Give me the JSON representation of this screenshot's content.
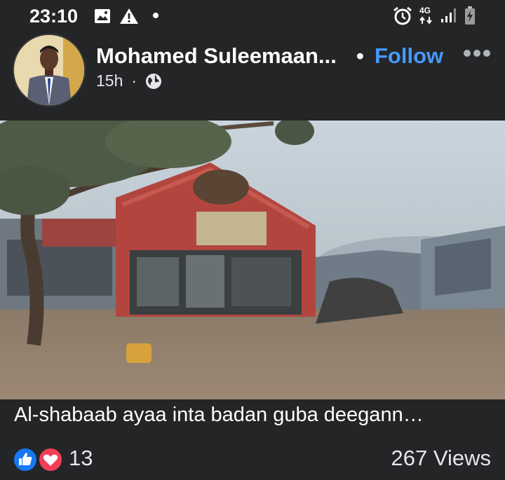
{
  "status_bar": {
    "time": "23:10",
    "network": "4G",
    "icons": [
      "image-icon",
      "warning-icon",
      "notification-dot-icon",
      "alarm-icon",
      "network-4g-icon",
      "signal-icon",
      "battery-charging-icon"
    ]
  },
  "post": {
    "author": "Mohamed Suleemaan...",
    "separator": "•",
    "follow_label": "Follow",
    "time_ago": "15h",
    "meta_separator": "·",
    "privacy_icon": "globe-icon",
    "caption": "Al-shabaab ayaa inta badan guba deegann…",
    "reaction_icons": [
      "like-icon",
      "love-icon"
    ],
    "reaction_count": "13",
    "views": "267 Views"
  },
  "colors": {
    "background": "#242526",
    "accent": "#4599ff",
    "like": "#1877f2",
    "love": "#f33e58"
  }
}
